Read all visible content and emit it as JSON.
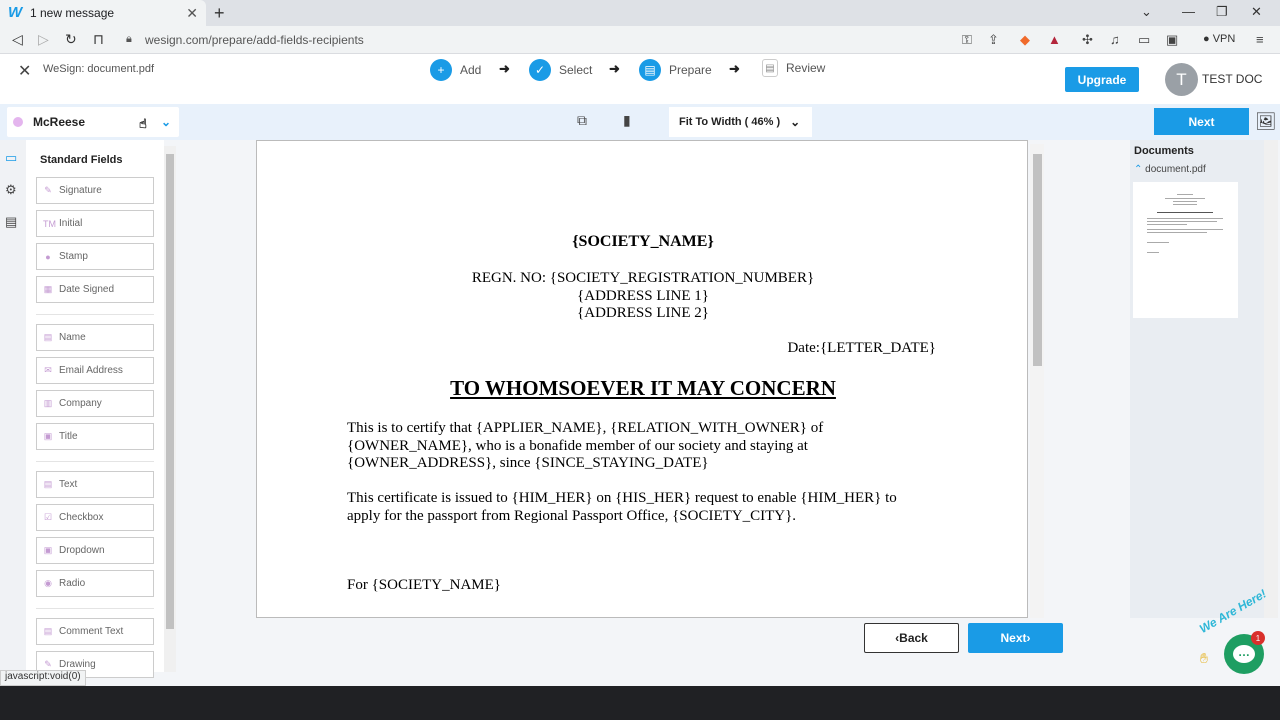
{
  "browser": {
    "tab_title": "1 new message",
    "new_tab": "+",
    "url": "wesign.com/prepare/add-fields-recipients",
    "vpn_label": "VPN",
    "status_text": "javascript:void(0)"
  },
  "header": {
    "doc_label": "WeSign: document.pdf",
    "steps": [
      {
        "label": "Add"
      },
      {
        "label": "Select"
      },
      {
        "label": "Prepare"
      },
      {
        "label": "Review"
      }
    ],
    "upgrade_label": "Upgrade",
    "avatar_initial": "T",
    "user_name": "TEST DOC"
  },
  "toolbar": {
    "recipient": "McReese",
    "zoom_label": "Fit To Width ( 46% )",
    "next_label": "Next"
  },
  "fields": {
    "title": "Standard Fields",
    "items": [
      {
        "label": "Signature",
        "icon": "pen-icon"
      },
      {
        "label": "Initial",
        "icon": "tm-icon",
        "glyph": "TM"
      },
      {
        "label": "Stamp",
        "icon": "stamp-icon"
      },
      {
        "label": "Date Signed",
        "icon": "calendar-icon"
      },
      {
        "label": "Name",
        "icon": "document-icon"
      },
      {
        "label": "Email Address",
        "icon": "email-icon"
      },
      {
        "label": "Company",
        "icon": "building-icon"
      },
      {
        "label": "Title",
        "icon": "title-icon"
      },
      {
        "label": "Text",
        "icon": "text-icon"
      },
      {
        "label": "Checkbox",
        "icon": "checkbox-icon"
      },
      {
        "label": "Dropdown",
        "icon": "dropdown-icon"
      },
      {
        "label": "Radio",
        "icon": "radio-icon"
      },
      {
        "label": "Comment Text",
        "icon": "comment-icon"
      },
      {
        "label": "Drawing",
        "icon": "drawing-icon"
      }
    ]
  },
  "document": {
    "society_name": "{SOCIETY_NAME}",
    "regn_line": "REGN. NO: {SOCIETY_REGISTRATION_NUMBER}",
    "address_1": "{ADDRESS LINE 1}",
    "address_2": "{ADDRESS LINE 2}",
    "date_line": "Date:{LETTER_DATE}",
    "heading": "TO WHOMSOEVER IT MAY CONCERN",
    "para1_l1": "This is to certify that {APPLIER_NAME}, {RELATION_WITH_OWNER} of",
    "para1_l2": "{OWNER_NAME}, who is a bonafide member of our society and staying at",
    "para1_l3": "{OWNER_ADDRESS}, since {SINCE_STAYING_DATE}",
    "para2_l1": "This certificate is issued to {HIM_HER} on {HIS_HER} request to enable {HIM_HER} to",
    "para2_l2": "apply for the passport from Regional Passport Office, {SOCIETY_CITY}.",
    "sign_line": "For {SOCIETY_NAME}"
  },
  "documents_panel": {
    "title": "Documents",
    "file": "document.pdf"
  },
  "footer": {
    "back_label": "Back",
    "next_label": "Next",
    "chat_badge": "1",
    "chat_banner": "We Are Here!"
  },
  "colors": {
    "accent": "#1a9be6",
    "recipient_dot": "#e4b5ee",
    "chat": "#1e9e62"
  }
}
